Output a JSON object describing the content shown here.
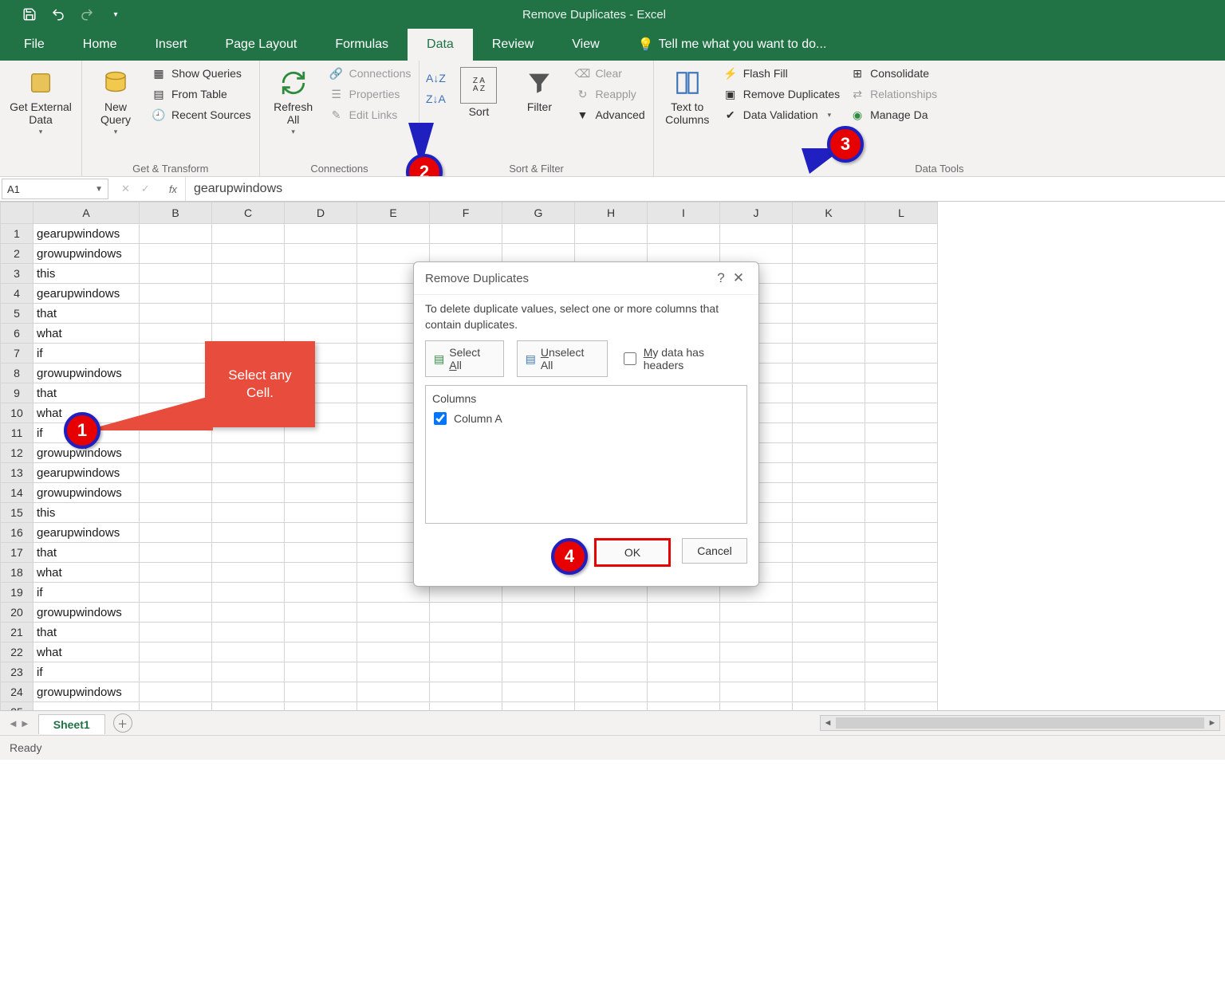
{
  "title": "Remove Duplicates - Excel",
  "tabs": {
    "file": "File",
    "home": "Home",
    "insert": "Insert",
    "pagelayout": "Page Layout",
    "formulas": "Formulas",
    "data": "Data",
    "review": "Review",
    "view": "View",
    "tellme": "Tell me what you want to do..."
  },
  "ribbon": {
    "get_external_data": "Get External\nData",
    "new_query": "New\nQuery",
    "show_queries": "Show Queries",
    "from_table": "From Table",
    "recent_sources": "Recent Sources",
    "group_get_transform": "Get & Transform",
    "refresh_all": "Refresh\nAll",
    "connections": "Connections",
    "properties": "Properties",
    "edit_links": "Edit Links",
    "group_connections": "Connections",
    "sort": "Sort",
    "filter": "Filter",
    "clear": "Clear",
    "reapply": "Reapply",
    "advanced": "Advanced",
    "group_sort_filter": "Sort & Filter",
    "text_to_columns": "Text to\nColumns",
    "flash_fill": "Flash Fill",
    "remove_duplicates": "Remove Duplicates",
    "data_validation": "Data Validation",
    "consolidate": "Consolidate",
    "relationships": "Relationships",
    "manage_data": "Manage Da",
    "group_data_tools": "Data Tools"
  },
  "namebox": "A1",
  "formula": "gearupwindows",
  "columns": [
    "A",
    "B",
    "C",
    "D",
    "E",
    "F",
    "G",
    "H",
    "I",
    "J",
    "K",
    "L"
  ],
  "rows": [
    "gearupwindows",
    "growupwindows",
    "this",
    "gearupwindows",
    "that",
    "what",
    "if",
    "growupwindows",
    "that",
    "what",
    "if",
    "growupwindows",
    "gearupwindows",
    "growupwindows",
    "this",
    "gearupwindows",
    "that",
    "what",
    "if",
    "growupwindows",
    "that",
    "what",
    "if",
    "growupwindows",
    ""
  ],
  "callout1": "Select any\nCell.",
  "dialog": {
    "title": "Remove Duplicates",
    "desc": "To delete duplicate values, select one or more columns that contain duplicates.",
    "select_all": "Select All",
    "unselect_all": "Unselect All",
    "has_headers": "My data has headers",
    "columns_label": "Columns",
    "column_a": "Column A",
    "ok": "OK",
    "cancel": "Cancel"
  },
  "sheet_tab": "Sheet1",
  "status": "Ready"
}
